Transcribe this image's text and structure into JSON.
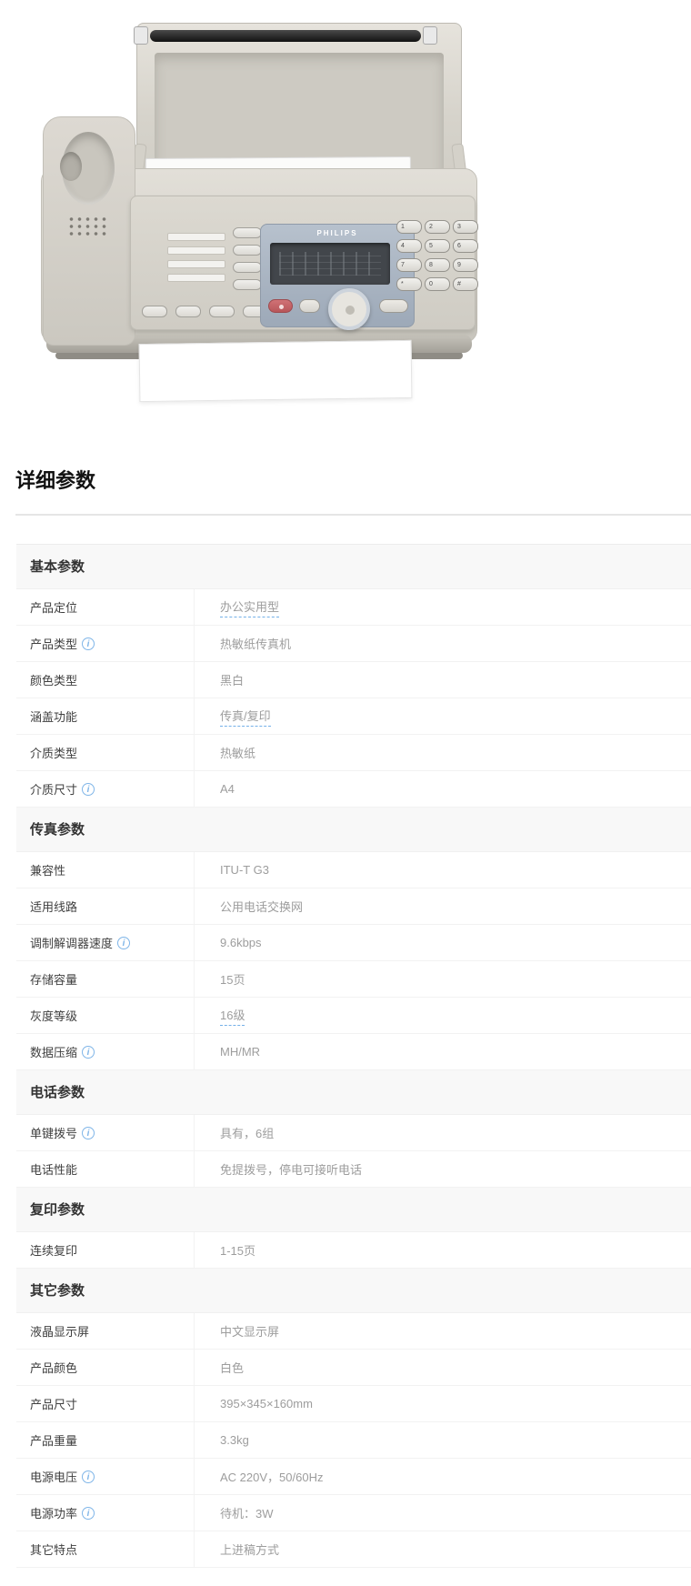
{
  "page": {
    "heading": "详细参数"
  },
  "icons": {
    "info_glyph": "i"
  },
  "product_image": {
    "brand": "PHILIPS",
    "keypad_keys": [
      "1",
      "2",
      "3",
      "4",
      "5",
      "6",
      "7",
      "8",
      "9",
      "*",
      "0",
      "#"
    ]
  },
  "spec_table": {
    "sections": [
      {
        "title": "基本参数",
        "rows": [
          {
            "label": "产品定位",
            "value": "办公实用型"
          },
          {
            "label": "产品类型",
            "value": "热敏纸传真机"
          },
          {
            "label": "颜色类型",
            "value": "黑白"
          },
          {
            "label": "涵盖功能",
            "value": "传真/复印"
          },
          {
            "label": "介质类型",
            "value": "热敏纸"
          },
          {
            "label": "介质尺寸",
            "value": "A4"
          }
        ]
      },
      {
        "title": "传真参数",
        "rows": [
          {
            "label": "兼容性",
            "value": "ITU-T G3"
          },
          {
            "label": "适用线路",
            "value": "公用电话交换网"
          },
          {
            "label": "调制解调器速度",
            "value": "9.6kbps"
          },
          {
            "label": "存储容量",
            "value": "15页"
          },
          {
            "label": "灰度等级",
            "value": "16级"
          },
          {
            "label": "数据压缩",
            "value": "MH/MR"
          }
        ]
      },
      {
        "title": "电话参数",
        "rows": [
          {
            "label": "单键拨号",
            "value": "具有，6组"
          },
          {
            "label": "电话性能",
            "value": "免提拨号，停电可接听电话"
          }
        ]
      },
      {
        "title": "复印参数",
        "rows": [
          {
            "label": "连续复印",
            "value": "1-15页"
          }
        ]
      },
      {
        "title": "其它参数",
        "rows": [
          {
            "label": "液晶显示屏",
            "value": "中文显示屏"
          },
          {
            "label": "产品颜色",
            "value": "白色"
          },
          {
            "label": "产品尺寸",
            "value": "395×345×160mm"
          },
          {
            "label": "产品重量",
            "value": "3.3kg"
          },
          {
            "label": "电源电压",
            "value": "AC 220V，50/60Hz"
          },
          {
            "label": "电源功率",
            "value": "待机：3W"
          },
          {
            "label": "其它特点",
            "value": "上进稿方式"
          }
        ]
      }
    ]
  }
}
